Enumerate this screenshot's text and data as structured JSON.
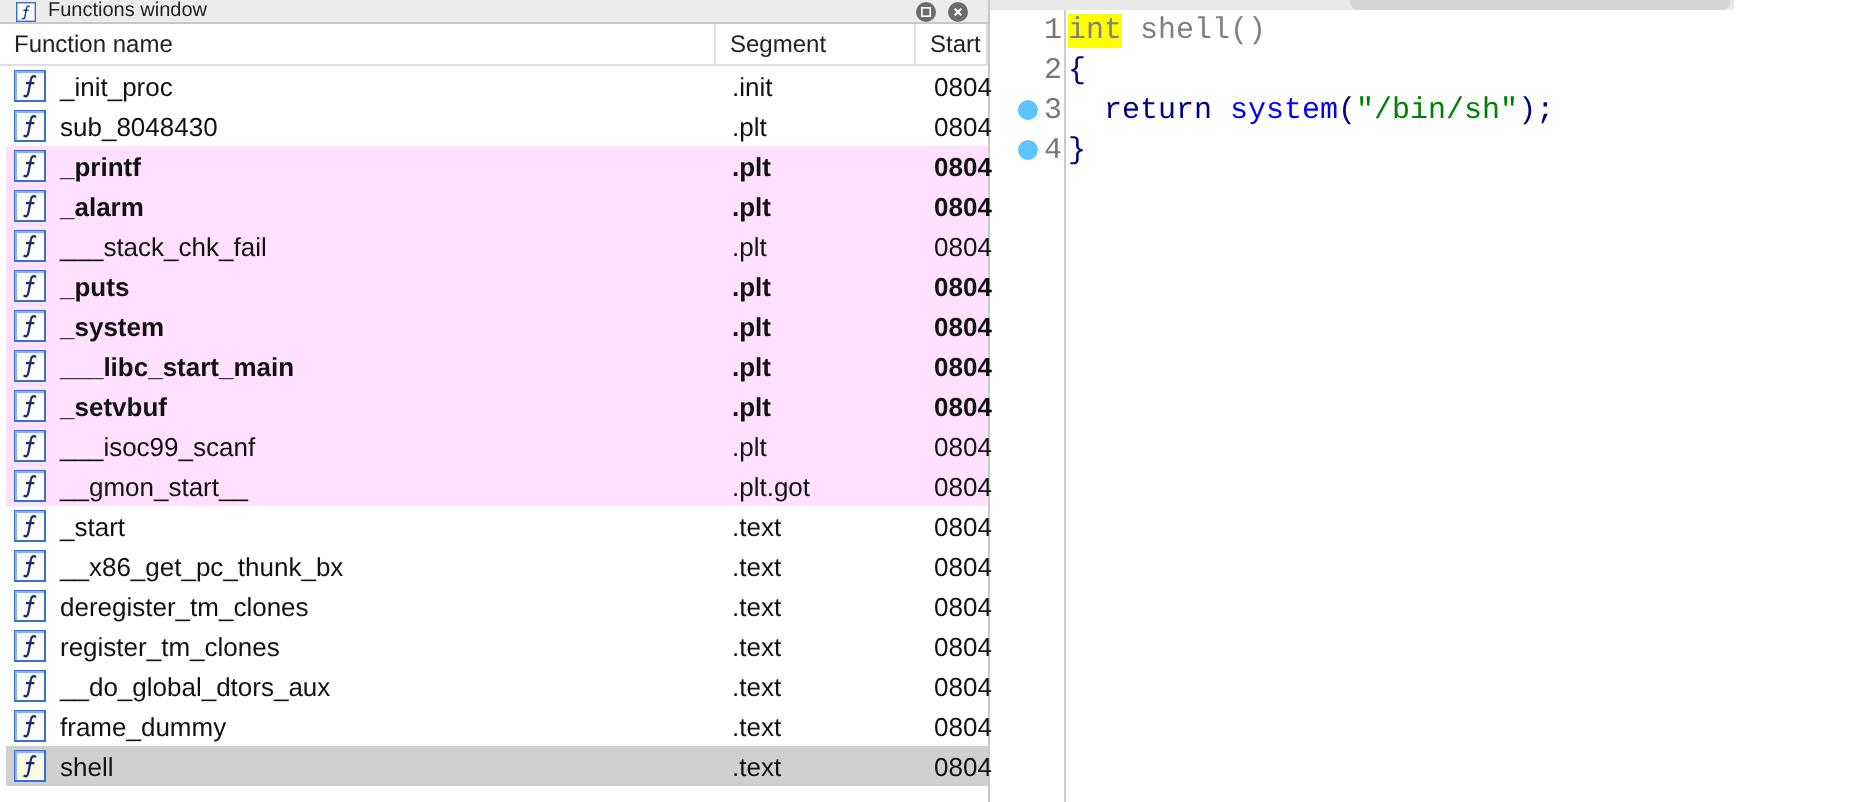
{
  "functions_window": {
    "title": "Functions window",
    "columns": [
      "Function name",
      "Segment",
      "Start"
    ],
    "rows": [
      {
        "name": "_init_proc",
        "segment": ".init",
        "start": "0804",
        "bold": false,
        "highlighted": false,
        "selected": false
      },
      {
        "name": "sub_8048430",
        "segment": ".plt",
        "start": "0804",
        "bold": false,
        "highlighted": false,
        "selected": false
      },
      {
        "name": "_printf",
        "segment": ".plt",
        "start": "0804",
        "bold": true,
        "highlighted": true,
        "selected": false
      },
      {
        "name": "_alarm",
        "segment": ".plt",
        "start": "0804",
        "bold": true,
        "highlighted": true,
        "selected": false
      },
      {
        "name": "___stack_chk_fail",
        "segment": ".plt",
        "start": "0804",
        "bold": false,
        "highlighted": true,
        "selected": false
      },
      {
        "name": "_puts",
        "segment": ".plt",
        "start": "0804",
        "bold": true,
        "highlighted": true,
        "selected": false
      },
      {
        "name": "_system",
        "segment": ".plt",
        "start": "0804",
        "bold": true,
        "highlighted": true,
        "selected": false
      },
      {
        "name": "___libc_start_main",
        "segment": ".plt",
        "start": "0804",
        "bold": true,
        "highlighted": true,
        "selected": false
      },
      {
        "name": "_setvbuf",
        "segment": ".plt",
        "start": "0804",
        "bold": true,
        "highlighted": true,
        "selected": false
      },
      {
        "name": "___isoc99_scanf",
        "segment": ".plt",
        "start": "0804",
        "bold": false,
        "highlighted": true,
        "selected": false
      },
      {
        "name": "__gmon_start__",
        "segment": ".plt.got",
        "start": "0804",
        "bold": false,
        "highlighted": true,
        "selected": false
      },
      {
        "name": "_start",
        "segment": ".text",
        "start": "0804",
        "bold": false,
        "highlighted": false,
        "selected": false
      },
      {
        "name": "__x86_get_pc_thunk_bx",
        "segment": ".text",
        "start": "0804",
        "bold": false,
        "highlighted": false,
        "selected": false
      },
      {
        "name": "deregister_tm_clones",
        "segment": ".text",
        "start": "0804",
        "bold": false,
        "highlighted": false,
        "selected": false
      },
      {
        "name": "register_tm_clones",
        "segment": ".text",
        "start": "0804",
        "bold": false,
        "highlighted": false,
        "selected": false
      },
      {
        "name": "__do_global_dtors_aux",
        "segment": ".text",
        "start": "0804",
        "bold": false,
        "highlighted": false,
        "selected": false
      },
      {
        "name": "frame_dummy",
        "segment": ".text",
        "start": "0804",
        "bold": false,
        "highlighted": false,
        "selected": false
      },
      {
        "name": "shell",
        "segment": ".text",
        "start": "0804",
        "bold": false,
        "highlighted": false,
        "selected": true
      }
    ]
  },
  "pseudocode": {
    "lines": [
      {
        "number": "1",
        "breakpoint": false,
        "tokens": [
          {
            "text": "int",
            "kind": "type",
            "highlighted": true
          },
          {
            "text": " shell()",
            "kind": "plain",
            "highlighted": false
          }
        ]
      },
      {
        "number": "2",
        "breakpoint": false,
        "tokens": [
          {
            "text": "{",
            "kind": "punct",
            "highlighted": false
          }
        ]
      },
      {
        "number": "3",
        "breakpoint": true,
        "tokens": [
          {
            "text": "  return ",
            "kind": "keyword",
            "highlighted": false
          },
          {
            "text": "system",
            "kind": "func",
            "highlighted": false
          },
          {
            "text": "(",
            "kind": "punct",
            "highlighted": false
          },
          {
            "text": "\"/bin/sh\"",
            "kind": "string",
            "highlighted": false
          },
          {
            "text": ");",
            "kind": "punct",
            "highlighted": false
          }
        ]
      },
      {
        "number": "4",
        "breakpoint": true,
        "tokens": [
          {
            "text": "}",
            "kind": "punct",
            "highlighted": false
          }
        ]
      }
    ]
  }
}
